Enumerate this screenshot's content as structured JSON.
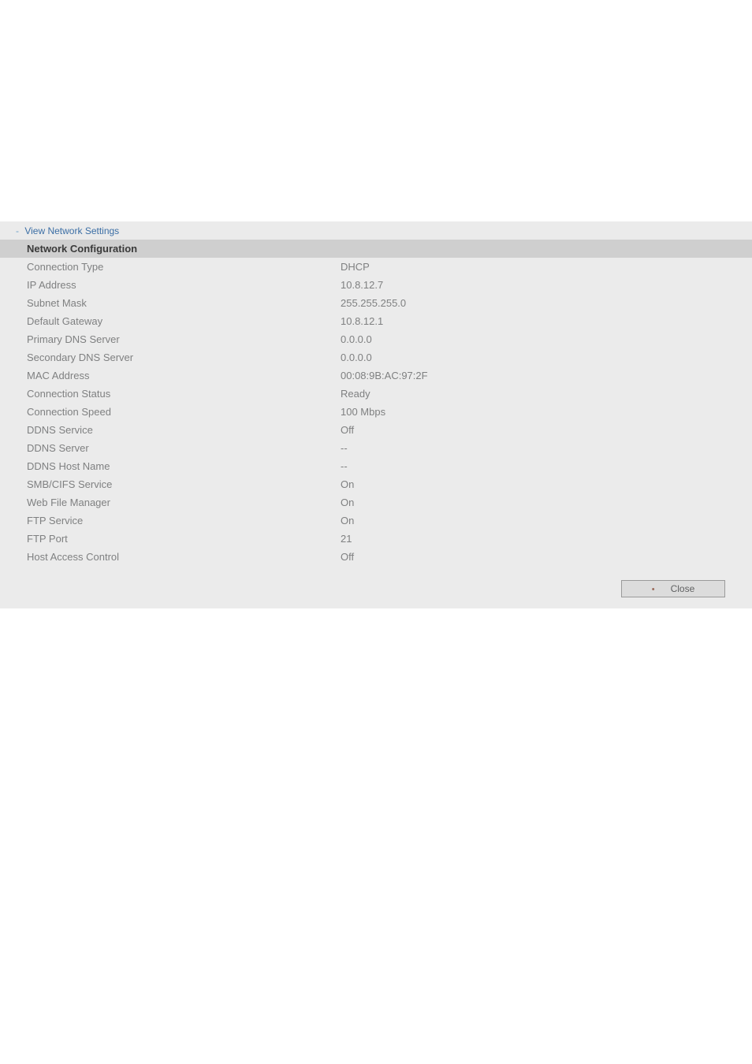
{
  "header": {
    "dash": "-",
    "title": "View Network Settings"
  },
  "section_header": "Network Configuration",
  "rows": [
    {
      "label": "Connection Type",
      "value": "DHCP"
    },
    {
      "label": "IP Address",
      "value": "10.8.12.7"
    },
    {
      "label": "Subnet Mask",
      "value": "255.255.255.0"
    },
    {
      "label": "Default Gateway",
      "value": "10.8.12.1"
    },
    {
      "label": "Primary DNS Server",
      "value": "0.0.0.0"
    },
    {
      "label": "Secondary DNS Server",
      "value": "0.0.0.0"
    },
    {
      "label": "MAC Address",
      "value": "00:08:9B:AC:97:2F"
    },
    {
      "label": "Connection Status",
      "value": "Ready"
    },
    {
      "label": "Connection Speed",
      "value": "100 Mbps"
    },
    {
      "label": "DDNS Service",
      "value": "Off"
    },
    {
      "label": "DDNS Server",
      "value": "--"
    },
    {
      "label": "DDNS Host Name",
      "value": "--"
    },
    {
      "label": "SMB/CIFS Service",
      "value": "On"
    },
    {
      "label": "Web File Manager",
      "value": "On"
    },
    {
      "label": "FTP Service",
      "value": "On"
    },
    {
      "label": "FTP Port",
      "value": "21"
    },
    {
      "label": "Host Access Control",
      "value": "Off"
    }
  ],
  "close_button": {
    "bullet": "•",
    "label": "Close"
  }
}
